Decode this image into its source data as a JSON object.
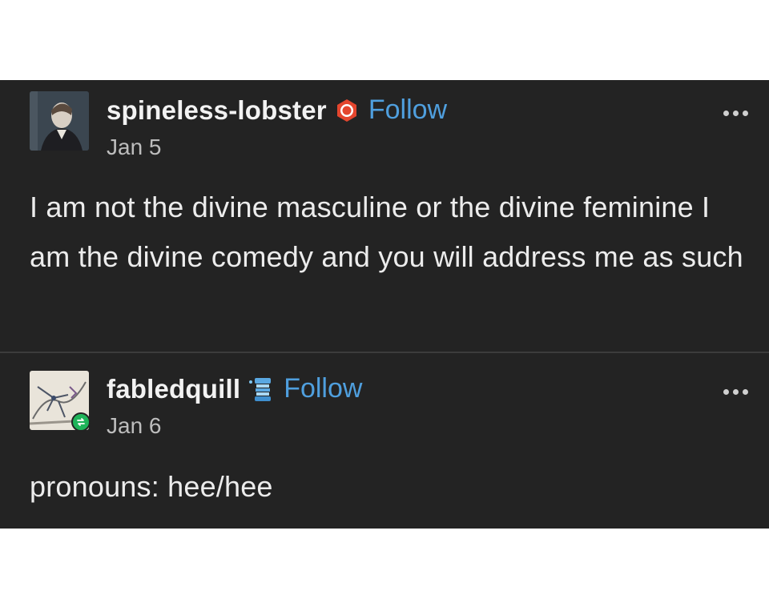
{
  "posts": [
    {
      "username": "spineless-lobster",
      "follow_label": "Follow",
      "date": "Jan 5",
      "body": "I am not the divine masculine or the divine feminine I am the divine comedy and you will address me as such",
      "badge_icon": "red-hexagon-badge-icon",
      "avatar_icon": "portrait-avatar"
    },
    {
      "username": "fabledquill",
      "follow_label": "Follow",
      "date": "Jan 6",
      "body": "pronouns: hee/hee",
      "badge_icon": "blue-scroll-badge-icon",
      "avatar_icon": "sketch-avatar",
      "reblog_indicator": "reblog-icon"
    }
  ],
  "colors": {
    "background": "#232323",
    "text": "#ececec",
    "follow": "#4f9fde",
    "reblog_badge": "#1fb45a"
  }
}
